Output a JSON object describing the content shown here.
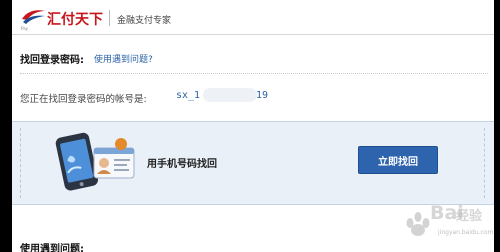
{
  "header": {
    "logo_icon": "swoosh-logo-icon",
    "logo_small_text": "Pay",
    "brand_name": "汇付天下",
    "tagline": "金融支付专家",
    "brand_color": "#c8161d"
  },
  "section": {
    "title": "找回登录密码:",
    "help_link": "使用遇到问题?"
  },
  "account": {
    "label": "您正在找回登录密码的帐号是:",
    "value_start": "sx_1",
    "value_end": "19"
  },
  "method": {
    "icon": "phone-id-card-icon",
    "label": "用手机号码找回",
    "button_label": "立即找回",
    "button_color": "#2e63ad"
  },
  "bottom": {
    "title": "使用遇到问题:"
  },
  "watermark": {
    "icon": "baidu-paw-icon",
    "text_main": "Bai",
    "text_cn": "经验",
    "sub_text": "jingyan.baidu.com"
  }
}
